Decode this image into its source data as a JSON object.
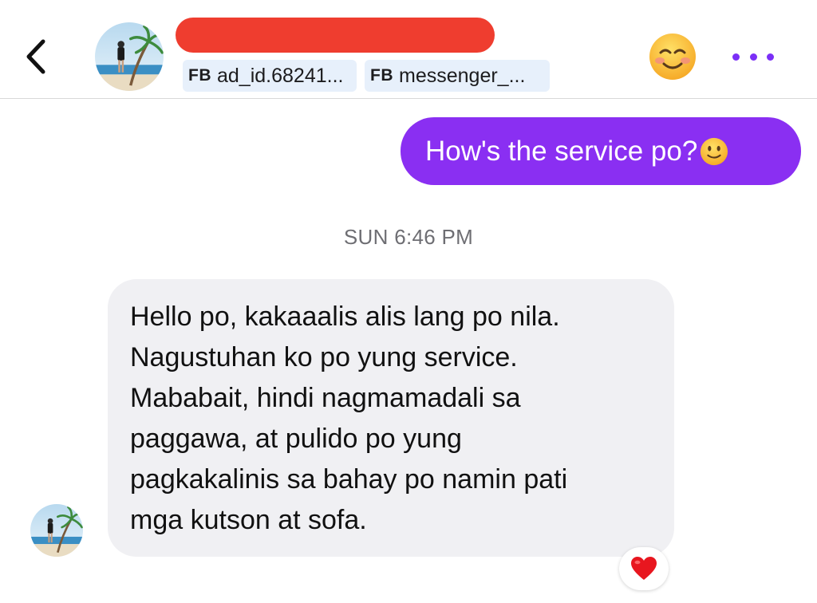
{
  "header": {
    "contact_name_redacted": true,
    "redaction_color": "#ef3d2f",
    "tags": [
      {
        "badge": "FB",
        "label": "ad_id.68241..."
      },
      {
        "badge": "FB",
        "label": "messenger_..."
      }
    ],
    "back_icon": "chevron-left-icon",
    "emoji_icon": "smiling-face-icon",
    "more_icon": "more-dots-icon",
    "accent_color": "#7b2ff7"
  },
  "messages": {
    "outgoing": {
      "text": "How's the service po?",
      "emoji_icon": "slightly-smiling-face-icon",
      "bubble_color": "#8a2ff2"
    },
    "timestamp": "SUN 6:46 PM",
    "incoming": {
      "lines": [
        "Hello po, kakaaalis alis lang po nila.",
        "Nagustuhan ko po yung service.",
        "Mababait, hindi nagmamadali sa",
        "paggawa, at pulido po yung",
        "pagkakalinis sa bahay po namin pati",
        "mga kutson at sofa."
      ],
      "bubble_color": "#f0f0f3",
      "reaction_icon": "red-heart-icon"
    }
  }
}
